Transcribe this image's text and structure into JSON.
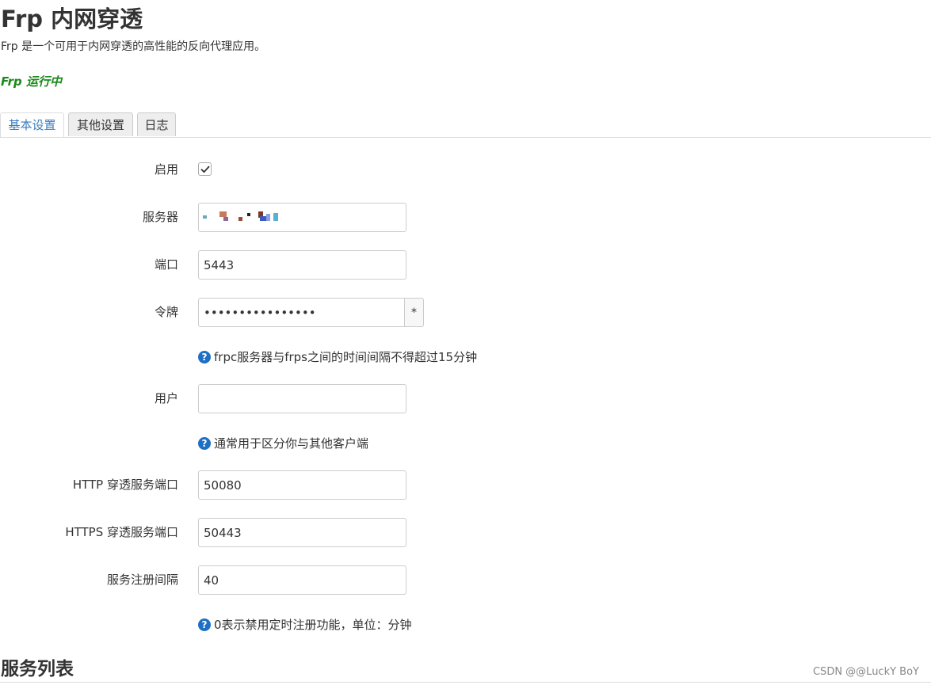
{
  "header": {
    "title": "Frp 内网穿透",
    "description": "Frp 是一个可用于内网穿透的高性能的反向代理应用。",
    "status": "Frp 运行中"
  },
  "tabs": [
    {
      "label": "基本设置",
      "active": true
    },
    {
      "label": "其他设置",
      "active": false
    },
    {
      "label": "日志",
      "active": false
    }
  ],
  "form": {
    "enable": {
      "label": "启用",
      "checked": true
    },
    "server": {
      "label": "服务器",
      "value": ""
    },
    "port": {
      "label": "端口",
      "value": "5443"
    },
    "token": {
      "label": "令牌",
      "value": "••••••••••••••••",
      "reveal_label": "*",
      "help": "frpc服务器与frps之间的时间间隔不得超过15分钟"
    },
    "user": {
      "label": "用户",
      "value": "",
      "help": "通常用于区分你与其他客户端"
    },
    "http_port": {
      "label": "HTTP 穿透服务端口",
      "value": "50080"
    },
    "https_port": {
      "label": "HTTPS 穿透服务端口",
      "value": "50443"
    },
    "register_interval": {
      "label": "服务注册间隔",
      "value": "40",
      "help": "0表示禁用定时注册功能，单位：分钟"
    }
  },
  "section": {
    "title": "服务列表"
  },
  "watermark": "CSDN @@LuckY BoY",
  "colors": {
    "status_green": "#1a8a1a",
    "tab_active_text": "#3a7dc0",
    "help_icon": "#1f6fc5"
  },
  "icons": {
    "help": "question-circle-icon",
    "check": "checkmark-icon"
  }
}
